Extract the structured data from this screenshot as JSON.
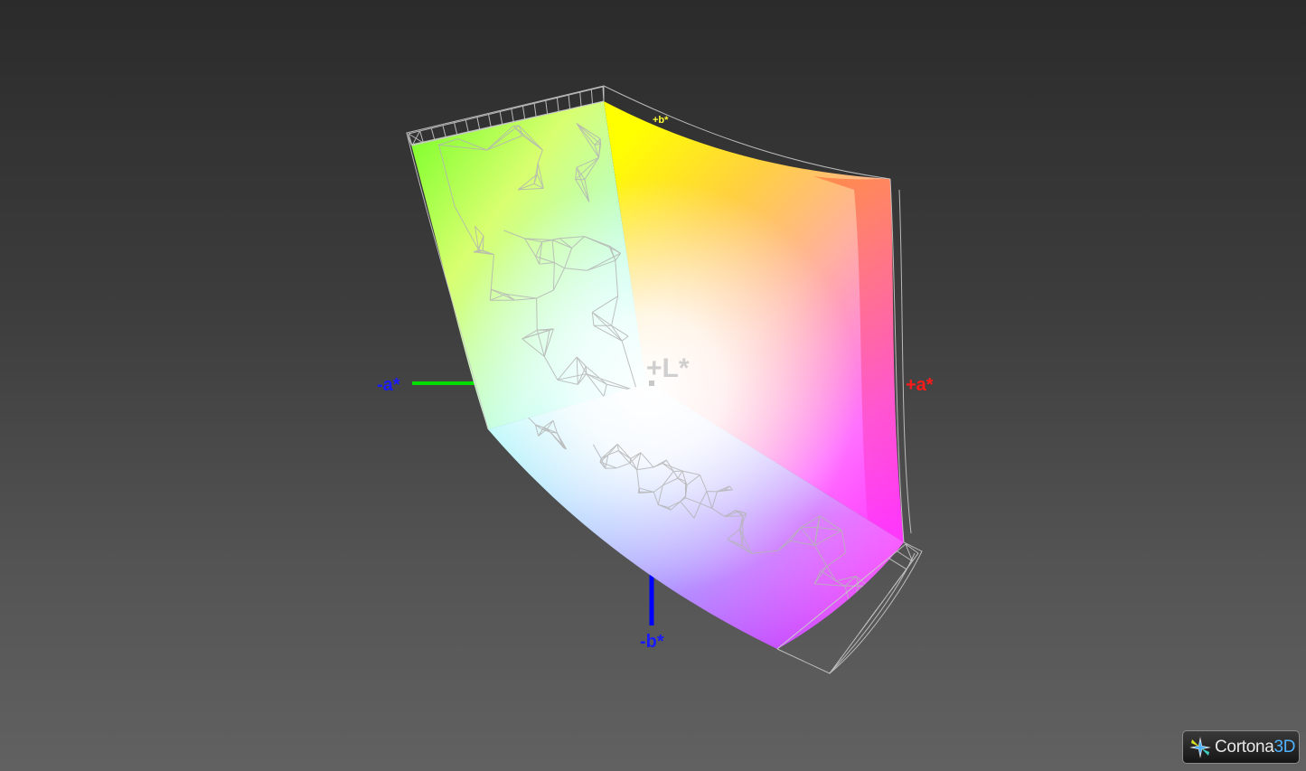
{
  "viewer": {
    "background_top": "#2b2b2b",
    "background_bottom": "#616161"
  },
  "axes": {
    "neg_a": {
      "label": "-a*",
      "label_color": "#1a1aff",
      "axis_color": "#00e000"
    },
    "pos_a": {
      "label": "+a*",
      "label_color": "#ff1a1a"
    },
    "neg_b": {
      "label": "-b*",
      "label_color": "#1a1aff",
      "axis_color": "#0000ff"
    },
    "pos_l": {
      "label": "+L*",
      "label_color": "#c8c8c8"
    },
    "pos_b": {
      "label": "+b*",
      "label_color": "#ffff33"
    }
  },
  "gamut": {
    "surface_colors": {
      "yellow": "#ffff00",
      "orange": "#ff8c20",
      "red": "#ff5a2a",
      "magenta": "#ff33ff",
      "blue": "#7070ff",
      "cyan": "#40ffff",
      "green": "#70ff20",
      "white": "#ffffff"
    },
    "wireframe_color": "#c8c8c8"
  },
  "logo": {
    "name_main": "Cortona",
    "name_accent": "3D"
  }
}
